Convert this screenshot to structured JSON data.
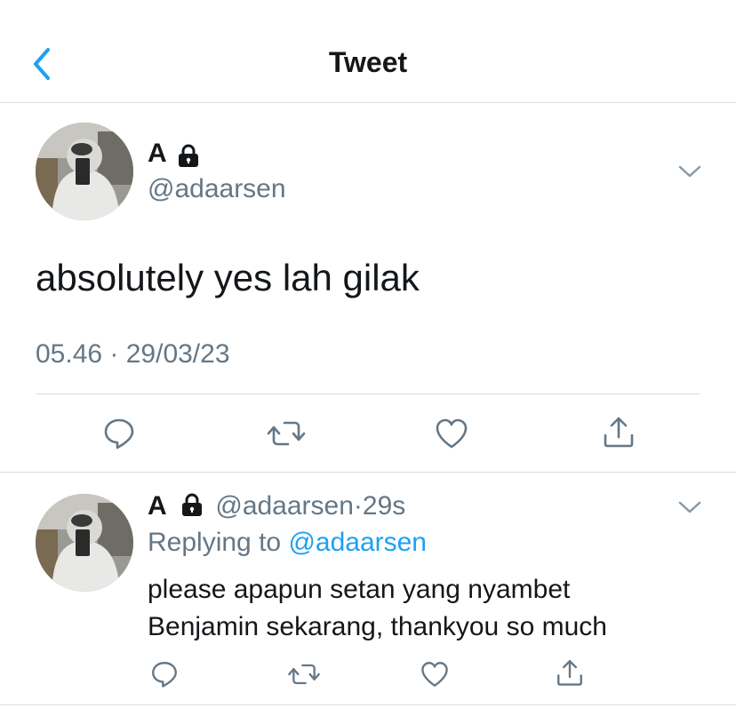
{
  "header": {
    "title": "Tweet",
    "back_icon": "back-chevron-icon"
  },
  "tweet": {
    "display_name": "A",
    "handle": "@adaarsen",
    "text": "absolutely yes lah gilak",
    "timestamp": "05.46 · 29/03/23",
    "protected": true
  },
  "reply": {
    "display_name": "A",
    "handle": "@adaarsen",
    "separator": "·",
    "age": "29s",
    "replying_prefix": "Replying to",
    "replying_to": "@adaarsen",
    "text_line1": "please apapun setan yang nyambet",
    "text_line2": "Benjamin sekarang, thankyou so much"
  },
  "actions": [
    "reply-icon",
    "retweet-icon",
    "like-icon",
    "share-icon"
  ],
  "colors": {
    "accent": "#1da1f2",
    "secondary_text": "#657786",
    "border": "#d7dce0"
  }
}
